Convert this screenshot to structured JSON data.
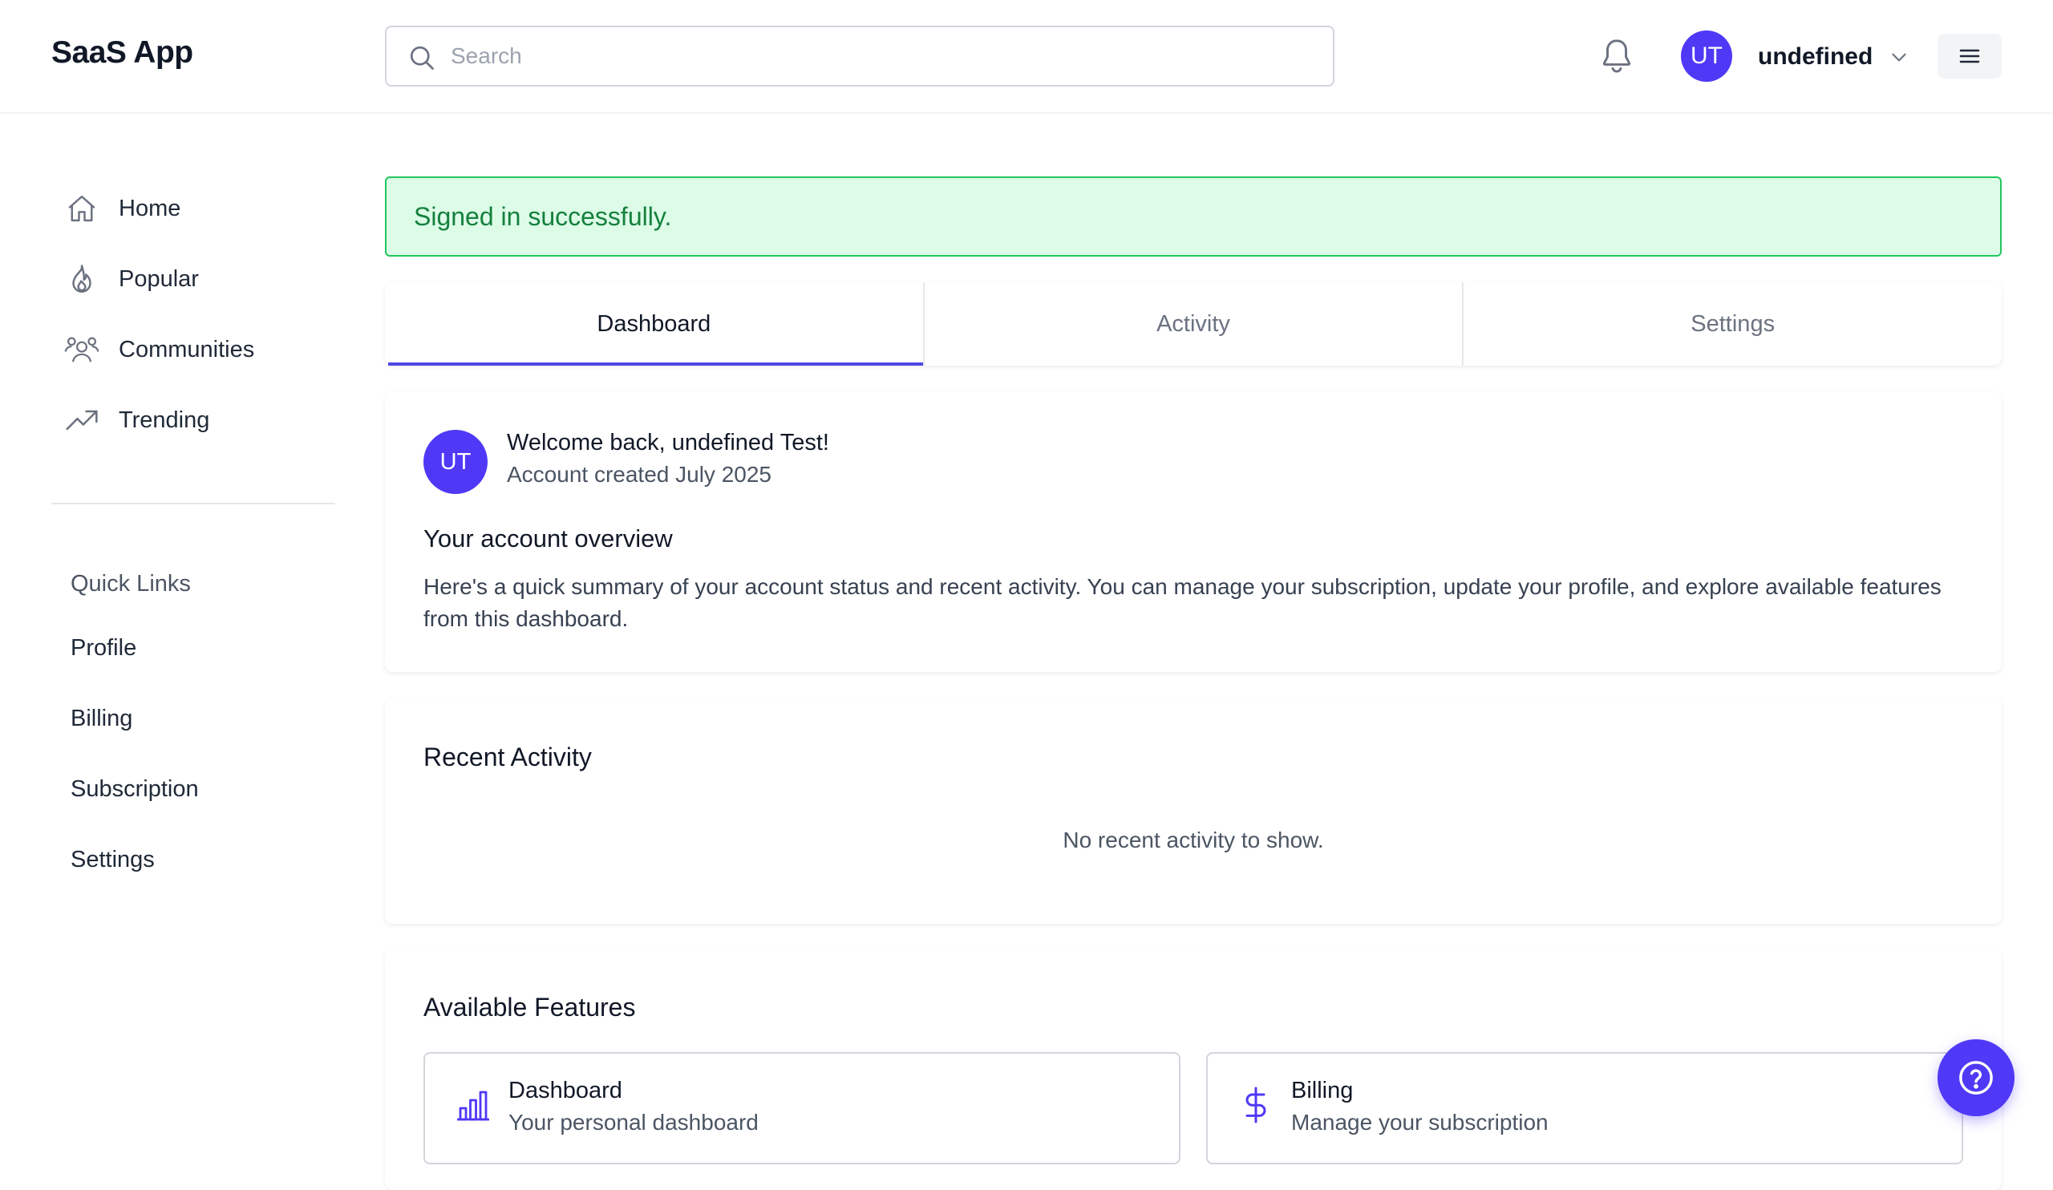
{
  "app": {
    "title": "SaaS App"
  },
  "header": {
    "search_placeholder": "Search",
    "avatar_initials": "UT",
    "user_name": "undefined"
  },
  "sidebar": {
    "items": [
      {
        "label": "Home",
        "icon": "home-icon"
      },
      {
        "label": "Popular",
        "icon": "flame-icon"
      },
      {
        "label": "Communities",
        "icon": "users-icon"
      },
      {
        "label": "Trending",
        "icon": "trending-up-icon"
      }
    ],
    "quick_links_title": "Quick Links",
    "quick_links": [
      "Profile",
      "Billing",
      "Subscription",
      "Settings"
    ]
  },
  "alert": {
    "message": "Signed in successfully.",
    "color": "#15803d"
  },
  "tabs": [
    {
      "label": "Dashboard",
      "active": true
    },
    {
      "label": "Activity",
      "active": false
    },
    {
      "label": "Settings",
      "active": false
    }
  ],
  "welcome": {
    "avatar_initials": "UT",
    "title": "Welcome back, undefined Test!",
    "subtitle": "Account created July 2025",
    "overview_title": "Your account overview",
    "overview_text": "Here's a quick summary of your account status and recent activity. You can manage your subscription, update your profile, and explore available features from this dashboard."
  },
  "activity": {
    "title": "Recent Activity",
    "empty_text": "No recent activity to show."
  },
  "features": {
    "title": "Available Features",
    "items": [
      {
        "title": "Dashboard",
        "description": "Your personal dashboard",
        "icon": "bar-chart-icon"
      },
      {
        "title": "Billing",
        "description": "Manage your subscription",
        "icon": "dollar-icon"
      }
    ]
  },
  "colors": {
    "accent": "#4f39f6",
    "success_bg": "#dcfce7",
    "success_border": "#22c55e"
  }
}
